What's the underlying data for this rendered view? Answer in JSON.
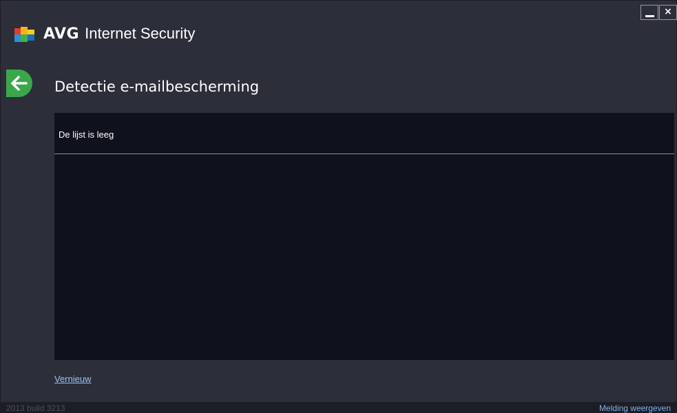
{
  "app": {
    "brand": "AVG",
    "product": "Internet Security"
  },
  "window_controls": {
    "minimize_icon": "minimize-icon",
    "close_label": "×"
  },
  "page": {
    "title": "Detectie e-mailbescherming"
  },
  "list": {
    "empty_text": "De lijst is leeg"
  },
  "actions": {
    "refresh_label": "Vernieuw"
  },
  "statusbar": {
    "build": "2013  build 3213",
    "notify_label": "Melding weergeven"
  },
  "colors": {
    "background": "#2c2e3a",
    "panel": "#0f111d",
    "accent_green": "#3aa84a",
    "link": "#9ec3f0"
  }
}
